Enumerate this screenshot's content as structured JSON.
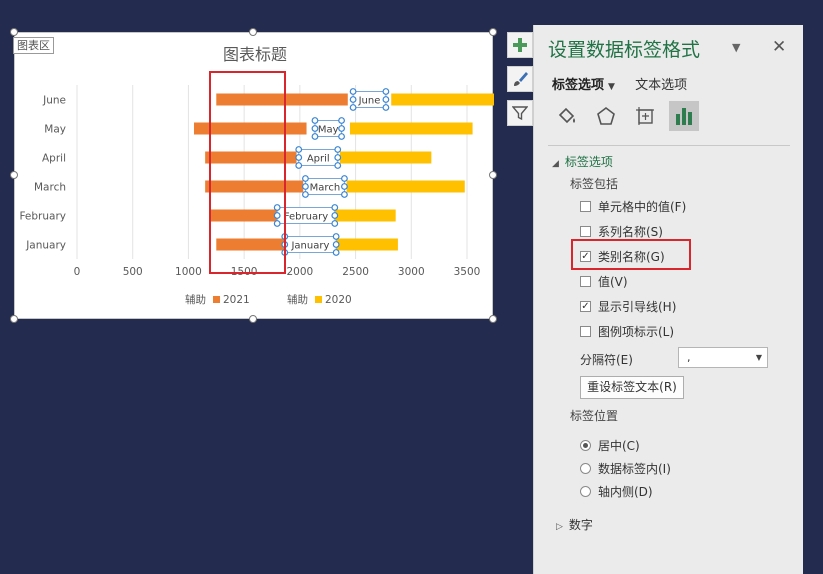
{
  "chart_area_tag": "图表区",
  "chart_data": {
    "type": "bar",
    "title": "图表标题",
    "categories": [
      "June",
      "May",
      "April",
      "March",
      "February",
      "January"
    ],
    "series": [
      {
        "name": "辅助",
        "values": [
          1250,
          1050,
          1150,
          1150,
          1200,
          1250
        ]
      },
      {
        "name": "2021",
        "values": [
          1180,
          1010,
          820,
          880,
          660,
          650
        ]
      },
      {
        "name": "辅助",
        "values": [
          390,
          390,
          390,
          390,
          390,
          390
        ]
      },
      {
        "name": "2020",
        "values": [
          1360,
          1100,
          820,
          1060,
          610,
          590
        ]
      }
    ],
    "stacked": true,
    "xlim": [
      0,
      3500
    ],
    "xticks": [
      0,
      500,
      1000,
      1500,
      2000,
      2500,
      3000,
      3500
    ],
    "grid": "vertical",
    "legend": "bottom",
    "data_labels": "category name",
    "colors": {
      "2021": "#ed7d31",
      "2020": "#ffc000"
    }
  },
  "side_tools": {
    "add": "plus-icon",
    "style": "brush-icon",
    "filter": "filter-icon"
  },
  "pane": {
    "title": "设置数据标签格式",
    "tabs": {
      "label_options": "标签选项",
      "text_options": "文本选项"
    },
    "section_label_options": "标签选项",
    "label_contains": "标签包括",
    "checkboxes": [
      {
        "label": "单元格中的值(F)",
        "checked": false
      },
      {
        "label": "系列名称(S)",
        "checked": false
      },
      {
        "label": "类别名称(G)",
        "checked": true
      },
      {
        "label": "值(V)",
        "checked": false
      },
      {
        "label": "显示引导线(H)",
        "checked": true
      },
      {
        "label": "图例项标示(L)",
        "checked": false
      }
    ],
    "separator_label": "分隔符(E)",
    "separator_value": ",",
    "reset_button": "重设标签文本(R)",
    "position_label": "标签位置",
    "positions": [
      {
        "label": "居中(C)",
        "selected": true
      },
      {
        "label": "数据标签内(I)",
        "selected": false
      },
      {
        "label": "轴内侧(D)",
        "selected": false
      }
    ],
    "number_section": "数字"
  },
  "accent_color": "#217346",
  "highlight_color": "#d9262c"
}
